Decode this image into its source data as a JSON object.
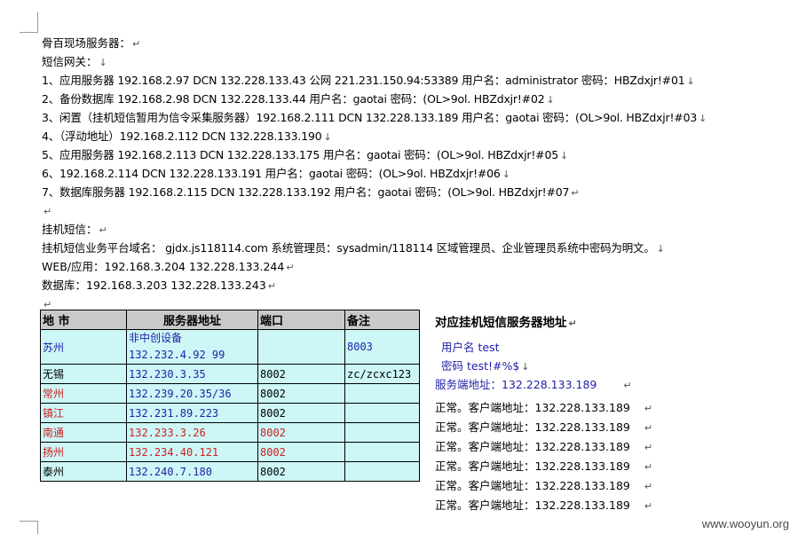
{
  "heading": "骨百现场服务器：",
  "sms_gateway": "短信网关：",
  "servers": [
    "1、应用服务器 192.168.2.97   DCN 132.228.133.43   公网 221.231.150.94:53389  用户名：administrator 密码：HBZdxjr!#01",
    "2、备份数据库 192.168.2.98   DCN 132.228.133.44   用户名：gaotai 密码：(OL>9ol. HBZdxjr!#02",
    "3、闲置（挂机短信暂用为信令采集服务器）192.168.2.111  DCN 132.228.133.189  用户名：gaotai 密码：(OL>9ol. HBZdxjr!#03",
    "4、（浮动地址）192.168.2.112  DCN 132.228.133.190",
    "5、应用服务器 192.168.2.113  DCN 132.228.133.175  用户名：gaotai 密码：(OL>9ol.   HBZdxjr!#05",
    "6、192.168.2.114  DCN 132.228.133.191  用户名：gaotai 密码：(OL>9ol. HBZdxjr!#06",
    "7、数据库服务器 192.168.2.115  DCN 132.228.133.192  用户名：gaotai 密码：(OL>9ol. HBZdxjr!#07"
  ],
  "hangup": {
    "title": "挂机短信：",
    "platform": "挂机短信业务平台域名： gjdx.js118114.com  系统管理员：sysadmin/118114 区域管理员、企业管理员系统中密码为明文。",
    "web": "WEB/应用：192.168.3.204  132.228.133.244",
    "db": "数据库：192.168.3.203 132.228.133.243"
  },
  "table": {
    "headers": [
      "地  市",
      "服务器地址",
      "端口",
      "备注"
    ],
    "rows": [
      {
        "city": "苏州",
        "addr_line1": "非中创设备",
        "addr_line2": "132.232.4.92 99",
        "port": "",
        "note": "8003"
      },
      {
        "city": "无锡",
        "addr_line1": "132.230.3.35",
        "port": "8002",
        "note": "zc/zcxc123"
      },
      {
        "city": "常州",
        "addr_line1": "132.239.20.35/36",
        "port": "8002",
        "note": ""
      },
      {
        "city": "镇江",
        "addr_line1": "132.231.89.223",
        "port": "8002",
        "note": ""
      },
      {
        "city": "南通",
        "addr_line1": "132.233.3.26",
        "port": "8002",
        "note": ""
      },
      {
        "city": "扬州",
        "addr_line1": "132.234.40.121",
        "port": "8002",
        "note": ""
      },
      {
        "city": "泰州",
        "addr_line1": "132.240.7.180",
        "port": "8002",
        "note": ""
      }
    ]
  },
  "side": {
    "header": "对应挂机短信服务器地址",
    "user": "用户名  test",
    "password": "密码  test!#%$",
    "service": "服务端地址：132.228.133.189",
    "status": [
      "正常。客户端地址：132.228.133.189",
      "正常。客户端地址：132.228.133.189",
      "正常。客户端地址：132.228.133.189",
      "正常。客户端地址：132.228.133.189",
      "正常。客户端地址：132.228.133.189",
      "正常。客户端地址：132.228.133.189"
    ]
  },
  "watermark": "www.wooyun.org",
  "colors": {
    "header_bg": "#c9c9c9",
    "cell_bg": "#cdf6f6",
    "blue_text": "#1f1fa8",
    "red_text": "#cc1f1f"
  }
}
